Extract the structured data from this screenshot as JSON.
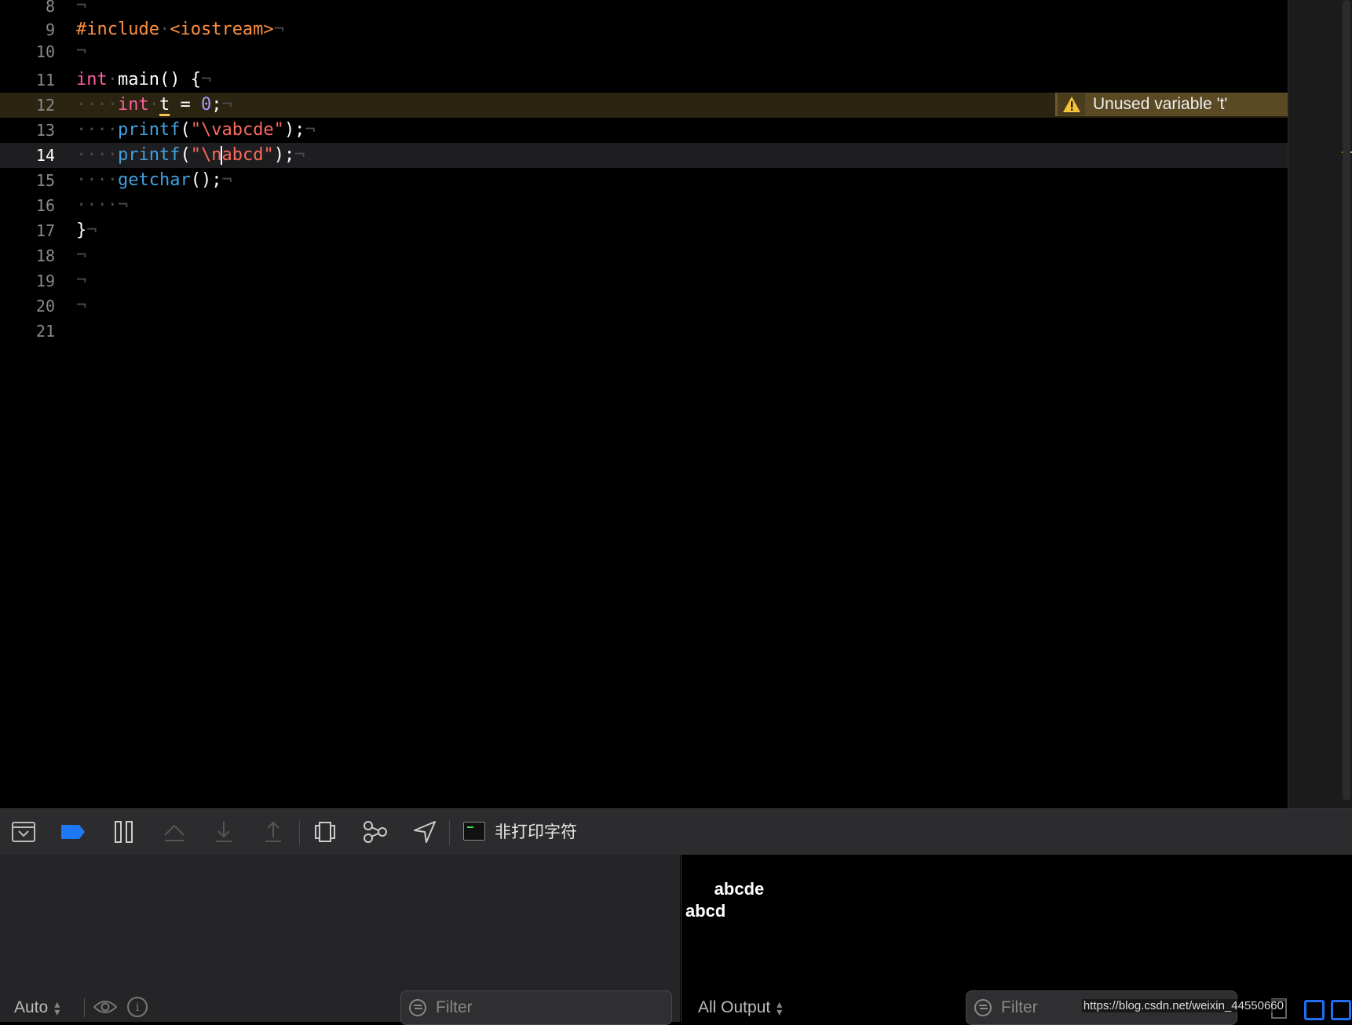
{
  "editor": {
    "lines": [
      {
        "num": "8"
      },
      {
        "num": "9"
      },
      {
        "num": "10"
      },
      {
        "num": "11"
      },
      {
        "num": "12"
      },
      {
        "num": "13"
      },
      {
        "num": "14"
      },
      {
        "num": "15"
      },
      {
        "num": "16"
      },
      {
        "num": "17"
      },
      {
        "num": "18"
      },
      {
        "num": "19"
      },
      {
        "num": "20"
      },
      {
        "num": "21"
      }
    ],
    "code": {
      "l9_directive": "#include",
      "l9_header": "<iostream>",
      "l11_kw": "int",
      "l11_rest": "main() {",
      "l12_kw": "int",
      "l12_var": "t",
      "l12_eq": " = ",
      "l12_num": "0",
      "l12_end": ";",
      "l13_fn": "printf",
      "l13_open": "(",
      "l13_str": "\"\\vabcde\"",
      "l13_close": ");",
      "l14_fn": "printf",
      "l14_open": "(",
      "l14_str_a": "\"\\n",
      "l14_str_b": "abcd\"",
      "l14_close": ");",
      "l15_fn": "getchar",
      "l15_rest": "();",
      "l17": "}",
      "pilcrow": "¬",
      "dot": "·"
    },
    "warning": {
      "icon": "warning-triangle-icon",
      "text": "Unused variable 't'"
    },
    "colors": {
      "keyword": "#fc5fa3",
      "preprocessor": "#fd8f3f",
      "function": "#41a1e0",
      "string": "#fc6a5d",
      "number": "#a79bfb"
    }
  },
  "debug_bar": {
    "target_label": "非打印字符",
    "icons": [
      "hide-debug-area-icon",
      "breakpoints-icon",
      "pause-icon",
      "step-over-icon",
      "step-into-icon",
      "step-out-icon",
      "view-hierarchy-icon",
      "memory-graph-icon",
      "simulate-location-icon",
      "terminal-icon"
    ]
  },
  "variables_pane": {
    "scope_popup": "Auto",
    "filter_placeholder": "Filter"
  },
  "console": {
    "output_line1": "      abcde",
    "output_line2": "abcd",
    "output_popup": "All Output",
    "filter_placeholder": "Filter",
    "watermark": "https://blog.csdn.net/weixin_44550660"
  }
}
